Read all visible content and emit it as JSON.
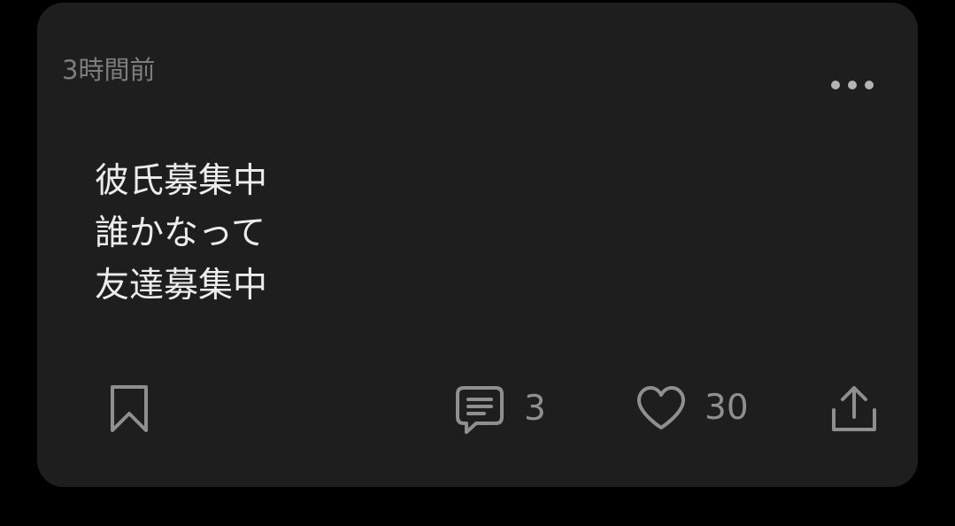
{
  "post": {
    "timestamp": "3時間前",
    "lines": [
      "彼氏募集中",
      "誰かなって",
      "友達募集中"
    ]
  },
  "actions": {
    "comment_count": "3",
    "like_count": "30"
  },
  "icons": {
    "more": "more-horizontal-icon",
    "bookmark": "bookmark-icon",
    "comment": "comment-icon",
    "like": "heart-icon",
    "share": "share-icon"
  },
  "colors": {
    "background": "#000000",
    "card": "#1e1e1e",
    "text_primary": "#ececec",
    "text_secondary": "#7d7d7d",
    "icon": "#8f8f8f"
  }
}
